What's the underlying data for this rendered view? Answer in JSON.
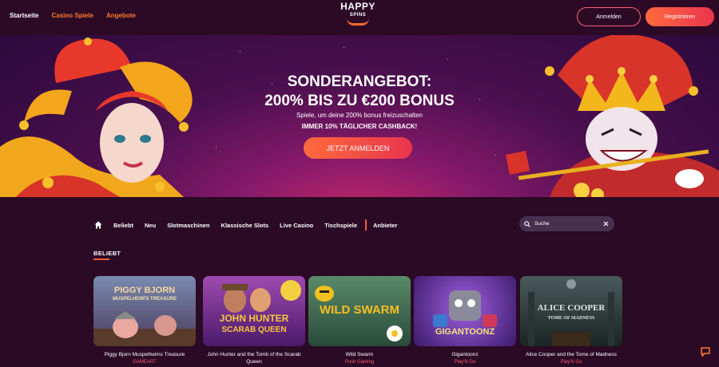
{
  "header": {
    "nav": [
      "Startseite",
      "Casino Spiele",
      "Angebote"
    ],
    "logo_line1": "HAPPY",
    "logo_line2": "SPINS",
    "login_label": "Anmelden",
    "register_label": "Registrieren",
    "colors": {
      "accent": "#ff6a3d",
      "accent2": "#e8344e",
      "nav_highlight": "#ff7a2a"
    }
  },
  "hero": {
    "title_line1": "SONDERANGEBOT:",
    "title_line2": "200% BIS ZU €200 BONUS",
    "subtitle": "Spiele, um deine 200% bonus freizuschalten",
    "cashback": "IMMER 10% TÄGLICHER CASHBACK!",
    "cta_label": "JETZT ANMELDEN"
  },
  "categories": {
    "home_icon": "home-icon",
    "items": [
      "Beliebt",
      "Neu",
      "Slotmaschinen",
      "Klassische Slots",
      "Live Casino",
      "Tischspiele"
    ],
    "after_divider": "Anbieter",
    "search_placeholder": "Suche"
  },
  "section": {
    "title": "BELIEBT"
  },
  "games": [
    {
      "art": "PIGGY BJORN",
      "art_sub": "MUSPELHEIM'S TREASURE",
      "title": "Piggy Bjorn Muspelheims Treasure",
      "provider": "GAMEART",
      "bg": "#5a6a8a"
    },
    {
      "art": "JOHN HUNTER",
      "art_sub": "SCARAB QUEEN",
      "title": "John Hunter and the Tomb of the Scarab Queen",
      "provider": "Pragmatic Play",
      "bg": "#7a2a8a"
    },
    {
      "art": "WILD SWARM",
      "art_sub": "",
      "title": "Wild Swarm",
      "provider": "Push Gaming",
      "bg": "#3f6a4a"
    },
    {
      "art": "GIGANTOONZ",
      "art_sub": "",
      "title": "Gigantoonz",
      "provider": "Play'N Go",
      "bg": "#5a2a8a"
    },
    {
      "art": "ALICE COOPER",
      "art_sub": "TOME OF MADNESS",
      "title": "Alice Cooper and the Tome of Madness",
      "provider": "Play'N Go",
      "bg": "#2e3a3a"
    }
  ]
}
